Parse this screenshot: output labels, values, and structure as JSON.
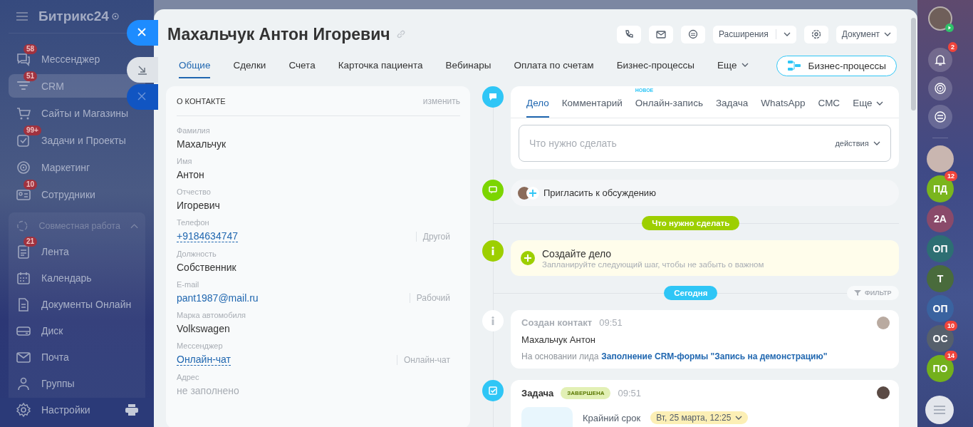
{
  "sidebar": {
    "logo": "Битрикс24",
    "items": [
      {
        "label": "Мессенджер",
        "badge": "58",
        "selected": false
      },
      {
        "label": "CRM",
        "badge": "51",
        "selected": true
      },
      {
        "label": "Сайты и Магазины",
        "selected": false
      },
      {
        "label": "Задачи и Проекты",
        "badge": "99+",
        "selected": false
      },
      {
        "label": "Маркетинг",
        "selected": false
      },
      {
        "label": "Сотрудники",
        "badge": "10",
        "selected": false
      }
    ],
    "group": {
      "label": "Совместная работа",
      "expanded": true,
      "items": [
        {
          "label": "Лента",
          "badge": "21",
          "selected": false
        },
        {
          "label": "Календарь",
          "selected": false
        },
        {
          "label": "Документы Онлайн",
          "selected": false
        },
        {
          "label": "Диск",
          "selected": false
        },
        {
          "label": "Почта",
          "selected": false
        },
        {
          "label": "Группы",
          "selected": false
        }
      ]
    },
    "settings": "Настройки"
  },
  "contact": {
    "title": "Махальчук Антон Игоревич",
    "header_buttons": [
      {
        "kind": "icon"
      },
      {
        "kind": "icon"
      },
      {
        "kind": "icon"
      },
      {
        "kind": "split",
        "label": "Расширения"
      },
      {
        "kind": "icon"
      },
      {
        "kind": "dropdown",
        "label": "Документ"
      }
    ],
    "tabs": [
      {
        "label": "Общие",
        "selected": true
      },
      {
        "label": "Сделки",
        "selected": false
      },
      {
        "label": "Счета",
        "selected": false
      },
      {
        "label": "Карточка пациента",
        "selected": false
      },
      {
        "label": "Вебинары",
        "selected": false
      },
      {
        "label": "Оплата по счетам",
        "selected": false
      },
      {
        "label": "Бизнес-процессы",
        "selected": false
      },
      {
        "label": "Еще",
        "selected": false,
        "menu": true
      }
    ],
    "action_button": "Бизнес-процессы",
    "about": {
      "title": "О КОНТАКТЕ",
      "edit": "изменить",
      "fields": [
        {
          "label": "Фамилия",
          "value": "Махальчук",
          "kind": "text"
        },
        {
          "label": "Имя",
          "value": "Антон",
          "kind": "text"
        },
        {
          "label": "Отчество",
          "value": "Игоревич",
          "kind": "text"
        },
        {
          "label": "Телефон",
          "value": "+9184634747",
          "kind": "link",
          "type": "Другой"
        },
        {
          "label": "Должность",
          "value": "Собственник",
          "kind": "text"
        },
        {
          "label": "E-mail",
          "value": "pant1987@mail.ru",
          "kind": "mail",
          "type": "Рабочий"
        },
        {
          "label": "Марка автомобиля",
          "value": "Volkswagen",
          "kind": "text"
        },
        {
          "label": "Мессенджер",
          "value": "Онлайн-чат",
          "kind": "link",
          "type": "Онлайн-чат"
        },
        {
          "label": "Адрес",
          "value": "не заполнено",
          "kind": "empty"
        }
      ]
    },
    "timeline": {
      "composer": {
        "tabs": [
          {
            "label": "Дело",
            "selected": true
          },
          {
            "label": "Комментарий",
            "selected": false
          },
          {
            "label": "Онлайн-запись",
            "selected": false,
            "badge": "НОВОЕ"
          },
          {
            "label": "Задача",
            "selected": false
          },
          {
            "label": "WhatsApp",
            "selected": false
          },
          {
            "label": "СМС",
            "selected": false
          },
          {
            "label": "Еще",
            "selected": false,
            "menu": true
          }
        ],
        "placeholder": "Что нужно сделать",
        "actions": "действия"
      },
      "invite": "Пригласить к обсуждению",
      "planned_divider": "Что нужно сделать",
      "create": {
        "title": "Создайте дело",
        "hint": "Запланируйте следующий шаг, чтобы не забыть о важном"
      },
      "today_divider": "Сегодня",
      "filter": "ФИЛЬТР",
      "events": [
        {
          "kind": "info",
          "title": "Создан контакт",
          "time": "09:51",
          "text": "Махальчук Антон",
          "source": "На основании лида",
          "link": "Заполнение CRM-формы \"Запись на демонстрацию\""
        },
        {
          "kind": "task",
          "title": "Задача",
          "status": "ЗАВЕРШЕНА",
          "time": "09:51",
          "deadline_label": "Крайний срок",
          "deadline": "Вт, 25 марта, 12:25"
        }
      ]
    }
  },
  "rightbar": {
    "notifications": "2",
    "chats": [
      {
        "initials": "ПД",
        "color": "#7ab51d",
        "badge": "12"
      },
      {
        "initials": "2А",
        "color": "#8a4a6a"
      },
      {
        "initials": "ОП",
        "color": "#2d6f73"
      },
      {
        "initials": "Т",
        "color": "#496b3c"
      },
      {
        "initials": "ОП",
        "color": "#3a63a0"
      },
      {
        "initials": "ОС",
        "color": "#56606c",
        "badge": "10"
      },
      {
        "initials": "ПО",
        "color": "#73b01c",
        "badge": "14"
      }
    ]
  }
}
